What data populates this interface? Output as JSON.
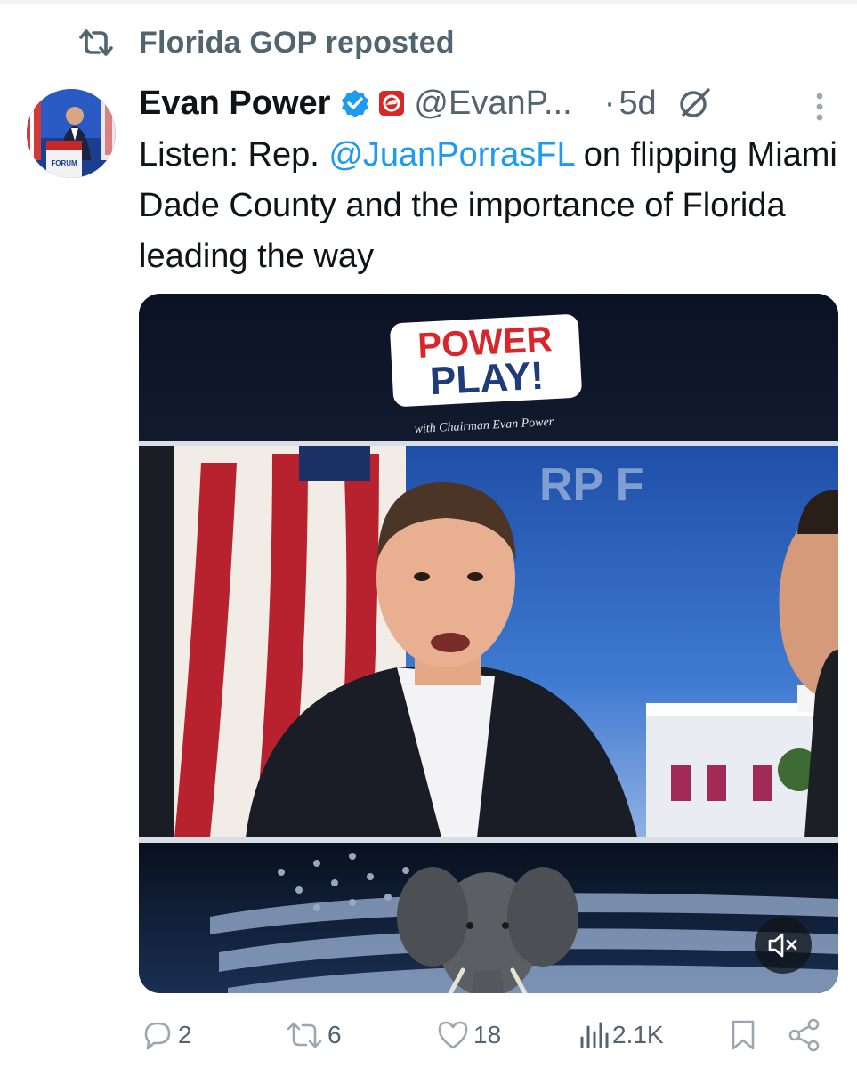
{
  "repost": {
    "icon": "repost-icon",
    "text": "Florida GOP reposted"
  },
  "author": {
    "name": "Evan Power",
    "verified_icon": "verified-badge-icon",
    "affiliation_icon": "affiliate-badge-icon",
    "handle": "@EvanP...",
    "separator": "·",
    "time": "5d",
    "grok_icon": "grok-icon",
    "avatar_text": "FORUM"
  },
  "tweet": {
    "text_before": "Listen: Rep. ",
    "mention": "@JuanPorrasFL",
    "text_after": " on flipping Miami Dade County and the importance of Florida leading the way"
  },
  "media": {
    "logo_line1": "POWER",
    "logo_line2": "PLAY!",
    "logo_tagline": "with Chairman Evan Power",
    "backdrop_text": "RP F",
    "mute_icon": "volume-muted-icon"
  },
  "actions": {
    "replies": "2",
    "reposts": "6",
    "likes": "18",
    "views": "2.1K"
  },
  "colors": {
    "accent": "#1d9bf0",
    "secondary_text": "#536471",
    "primary_text": "#0f1419"
  }
}
